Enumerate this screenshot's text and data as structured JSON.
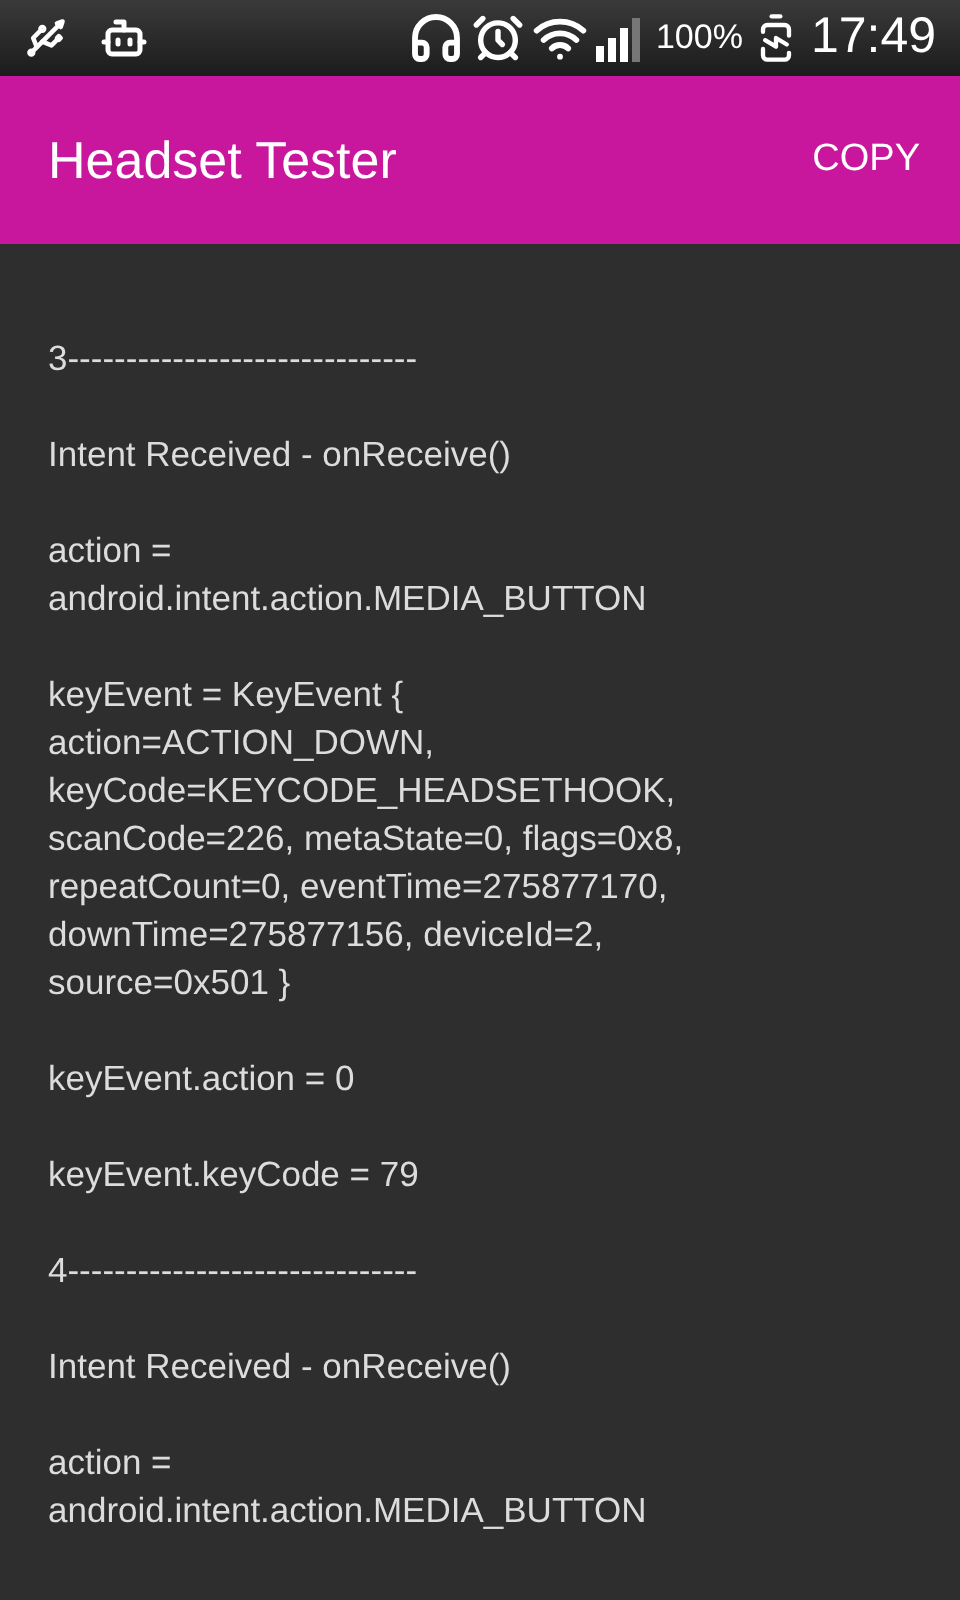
{
  "status_bar": {
    "battery": "100%",
    "time": "17:49"
  },
  "app_bar": {
    "title": "Headset Tester",
    "action": "COPY"
  },
  "log": [
    {
      "lines": [
        "3------------------------------"
      ]
    },
    {
      "lines": [
        "Intent Received - onReceive()"
      ]
    },
    {
      "lines": [
        "action =",
        "android.intent.action.MEDIA_BUTTON"
      ]
    },
    {
      "lines": [
        "keyEvent = KeyEvent {",
        "action=ACTION_DOWN,",
        "keyCode=KEYCODE_HEADSETHOOK,",
        "scanCode=226, metaState=0, flags=0x8,",
        "repeatCount=0, eventTime=275877170,",
        "downTime=275877156, deviceId=2,",
        "source=0x501 }"
      ]
    },
    {
      "lines": [
        "keyEvent.action = 0"
      ]
    },
    {
      "lines": [
        "keyEvent.keyCode = 79"
      ]
    },
    {
      "lines": [
        "4------------------------------"
      ]
    },
    {
      "lines": [
        "Intent Received - onReceive()"
      ]
    },
    {
      "lines": [
        "action =",
        "android.intent.action.MEDIA_BUTTON"
      ]
    }
  ]
}
